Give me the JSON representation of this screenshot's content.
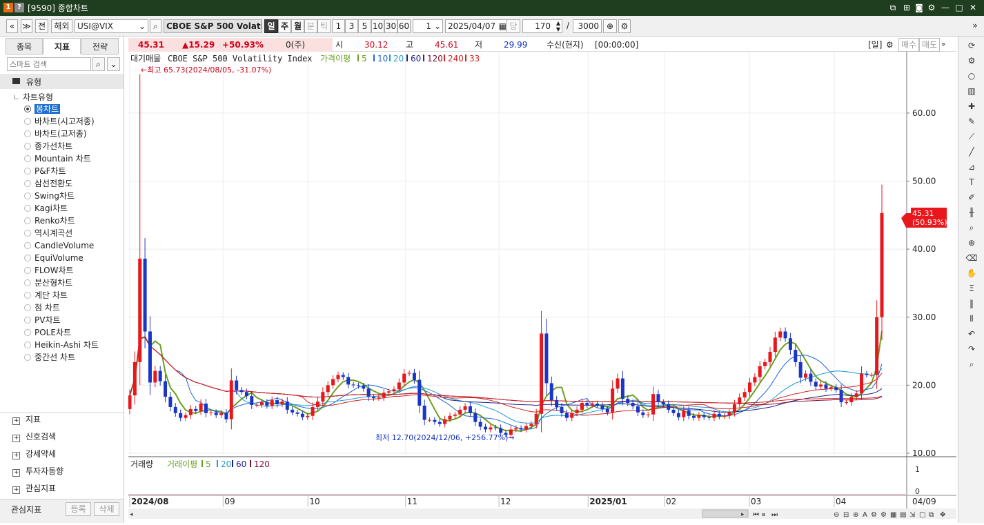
{
  "window": {
    "code_icon_1": "1",
    "code_icon_2": "?",
    "title": "[9590] 종합차트"
  },
  "toolbar": {
    "prev": "«",
    "menu": "≫",
    "all_label": "전",
    "market": "해외",
    "symbol_code": "USI@VIX",
    "symbol_name": "CBOE S&P 500 Volatil",
    "period_day": "일",
    "period_week": "주",
    "period_month": "월",
    "period_min": "분",
    "period_tick": "틱",
    "intervals": [
      "1",
      "3",
      "5",
      "10",
      "30",
      "60"
    ],
    "unit_value": "1",
    "date": "2025/04/07",
    "today_label": "당",
    "count": "170",
    "slash": "/",
    "total": "3000"
  },
  "left_panel": {
    "tabs": [
      "종목",
      "지표",
      "전략"
    ],
    "search_placeholder": "스마트 검색",
    "root_label": "유형",
    "group_label": "차트유형",
    "chart_types": [
      "봉차트",
      "바차트(시고저종)",
      "바차트(고저종)",
      "종가선차트",
      "Mountain 차트",
      "P&F차트",
      "삼선전환도",
      "Swing차트",
      "Kagi차트",
      "Renko차트",
      "역시계곡선",
      "CandleVolume",
      "EquiVolume",
      "FLOW차트",
      "분산형차트",
      "계단 차트",
      "점 차트",
      "PV차트",
      "POLE차트",
      "Heikin-Ashi 차트",
      "중간선 차트"
    ],
    "selected_index": 0,
    "sections": [
      "지표",
      "신호검색",
      "강세약세",
      "투자자동향",
      "관심지표"
    ],
    "footer_label": "관심지표",
    "register_button": "등록",
    "delete_button": "삭제"
  },
  "quote": {
    "price": "45.31",
    "change": "▲15.29",
    "change_pct": "+50.93%",
    "volume": "0(주)",
    "open_label": "시",
    "open": "30.12",
    "high_label": "고",
    "high": "45.61",
    "low_label": "저",
    "low": "29.99",
    "receive": "수신(현지)",
    "time": "[00:00:00]",
    "period_box": "[일]",
    "buy": "매수",
    "sell": "매도"
  },
  "chart_data": {
    "type": "candlestick",
    "title": "CBOE S&P 500 Volatility Index",
    "legend": {
      "prefix": "대기매물",
      "ma_label": "가격이평",
      "ma_periods": [
        "5",
        "10",
        "20",
        "60",
        "120",
        "240",
        "33"
      ],
      "ma_colors": [
        "#6aa020",
        "#1a64d8",
        "#1a9ad8",
        "#202080",
        "#801030",
        "#d02020",
        "#d02020"
      ]
    },
    "ylim": [
      10,
      68
    ],
    "y_ticks": [
      "60.00",
      "50.00",
      "40.00",
      "30.00",
      "20.00",
      "10.00"
    ],
    "x_labels": [
      "2024/08",
      "09",
      "10",
      "11",
      "12",
      "2025/01",
      "02",
      "03",
      "04"
    ],
    "x_label_end": "04/09",
    "annotations": {
      "high": "←최고 65.73(2024/08/05, -31.07%)",
      "low": "최저 12.70(2024/12/06, +256.77%)→"
    },
    "last_price": "45.31",
    "last_pct": "(50.93%)",
    "closes": [
      18.5,
      23.4,
      38.6,
      27.9,
      20.4,
      22.1,
      20.6,
      18.3,
      16.8,
      15.9,
      15.2,
      15.6,
      16.5,
      16.2,
      17.3,
      15.9,
      16.0,
      15.6,
      15.9,
      15.0,
      20.7,
      19.3,
      19.0,
      18.4,
      17.1,
      17.1,
      17.5,
      17.0,
      17.8,
      17.2,
      17.6,
      16.4,
      16.0,
      15.8,
      15.3,
      15.5,
      16.8,
      17.6,
      19.0,
      20.0,
      20.9,
      21.5,
      21.2,
      20.1,
      20.0,
      19.9,
      19.5,
      18.3,
      18.1,
      18.2,
      18.9,
      19.1,
      19.4,
      20.4,
      21.7,
      21.8,
      20.8,
      17.0,
      14.9,
      14.9,
      14.6,
      14.3,
      15.0,
      15.5,
      15.7,
      16.4,
      16.9,
      15.9,
      14.6,
      13.9,
      13.5,
      13.8,
      13.7,
      13.0,
      12.7,
      13.5,
      13.7,
      13.5,
      14.0,
      14.3,
      15.8,
      27.6,
      20.3,
      17.8,
      16.8,
      15.9,
      15.2,
      15.9,
      16.4,
      17.4,
      17.1,
      17.3,
      17.0,
      16.5,
      16.0,
      19.5,
      21.0,
      18.0,
      17.4,
      16.9,
      16.0,
      15.6,
      15.7,
      18.7,
      17.5,
      17.2,
      16.4,
      15.9,
      15.3,
      16.3,
      15.5,
      15.2,
      15.6,
      15.3,
      15.2,
      15.8,
      15.4,
      15.5,
      16.0,
      17.2,
      18.2,
      19.0,
      20.4,
      21.2,
      22.8,
      23.4,
      24.9,
      27.0,
      27.9,
      26.9,
      25.2,
      23.4,
      21.1,
      21.7,
      20.5,
      19.8,
      20.1,
      19.5,
      19.7,
      19.3,
      17.5,
      17.5,
      18.3,
      18.8,
      21.7,
      21.5,
      21.5,
      30.0,
      45.31
    ]
  },
  "volume_panel": {
    "title": "거래량",
    "ma_label": "거래이평",
    "ma_periods": [
      "5",
      "20",
      "60",
      "120"
    ],
    "y_ticks": [
      "1",
      "0"
    ]
  },
  "colors": {
    "up": "#e8171c",
    "down": "#1a36c8",
    "titlebar": "#1f3d1f",
    "accent": "#1f6fd0"
  }
}
